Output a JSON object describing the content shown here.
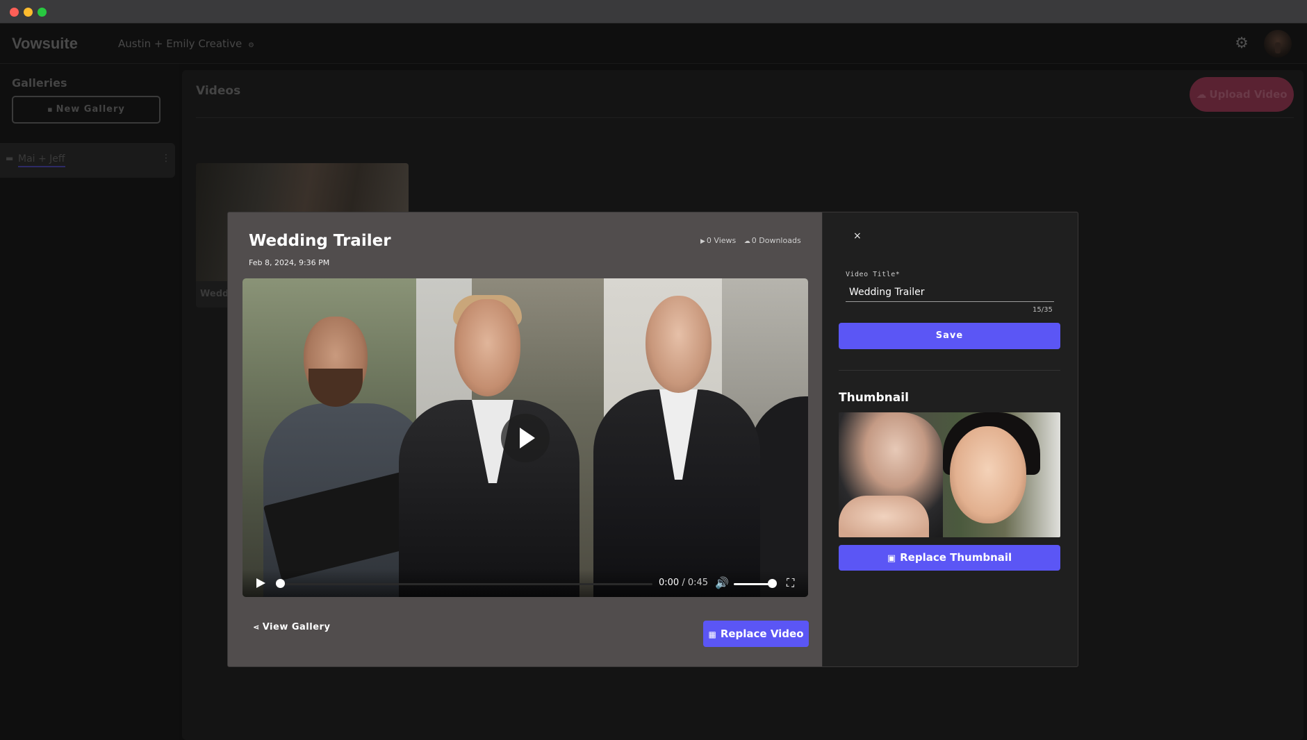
{
  "app": {
    "brand": "Vowsuite",
    "workspace": "Austin + Emily Creative",
    "workspace_icon": "gear-small-icon"
  },
  "sidebar": {
    "title": "Galleries",
    "new_gallery_label": "New Gallery",
    "items": [
      {
        "label": "Mai + Jeff"
      }
    ]
  },
  "main": {
    "title": "Videos",
    "upload_label": "Upload Video",
    "video_card_label": "Wedding Trailer"
  },
  "modal": {
    "title": "Wedding Trailer",
    "date": "Feb 8, 2024, 9:36 PM",
    "views": "0 Views",
    "downloads": "0 Downloads",
    "player": {
      "current_time": "0:00",
      "separator": " / ",
      "duration": "0:45",
      "progress": 0,
      "volume": 1
    },
    "view_gallery_label": "View Gallery",
    "replace_video_label": "Replace Video",
    "form": {
      "field_label": "Video Title*",
      "title_value": "Wedding Trailer",
      "char_count": "15/35",
      "save_label": "Save"
    },
    "thumbnail": {
      "heading": "Thumbnail",
      "replace_label": "Replace Thumbnail"
    },
    "close_label": "×"
  },
  "colors": {
    "accent": "#5b56f5",
    "upload_button": "#5a2232"
  }
}
